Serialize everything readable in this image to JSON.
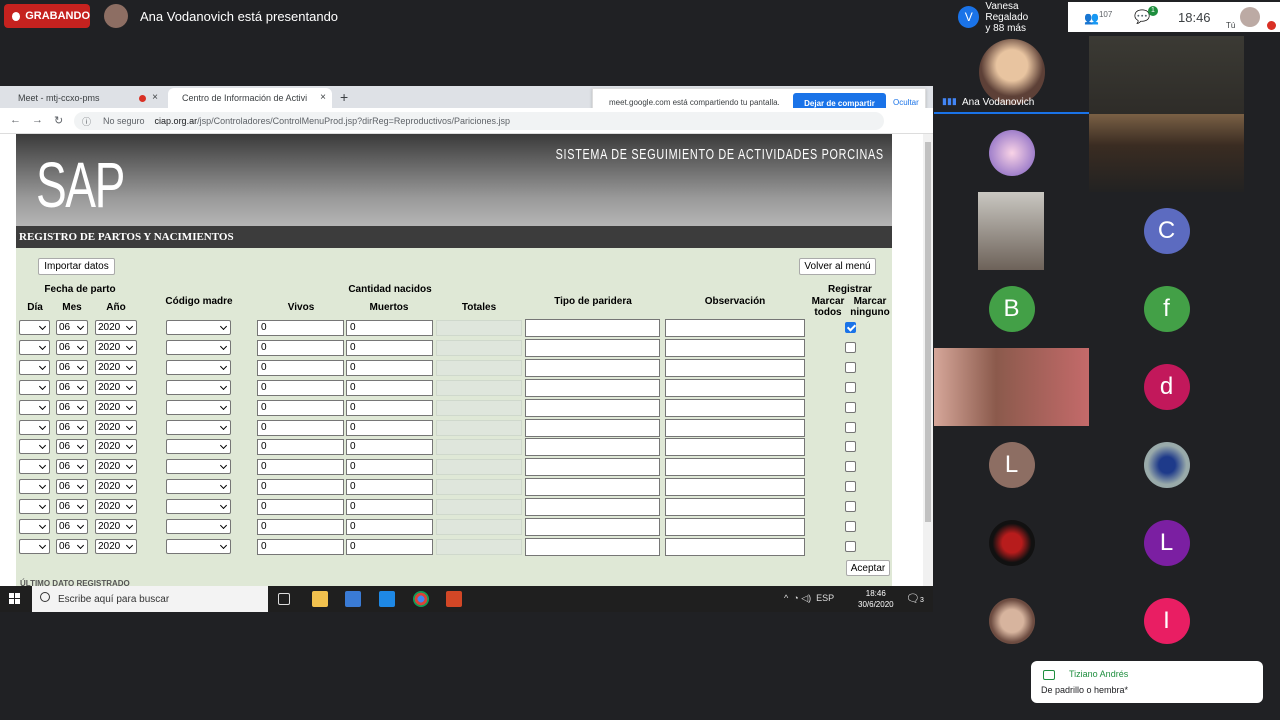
{
  "meet": {
    "recording_label": "GRABANDO",
    "presenting_text": "Ana Vodanovich está presentando",
    "participants_box": {
      "line1": "Vanesa Regalado",
      "line2": "y 88 más",
      "initial": "V"
    },
    "people_count": "107",
    "chat_badge": "1",
    "clock": "18:46",
    "self_label": "Tú",
    "speaker_name": "Ana Vodanovich",
    "tiles": [
      "C",
      "B",
      "f",
      "d",
      "L",
      "L",
      "I"
    ],
    "toast": {
      "name": "Tiziano Andrés",
      "message": "De padrillo o hembra*"
    }
  },
  "browser": {
    "tab1": "Meet - mtj-ccxo-pms",
    "tab2": "Centro de Información de Activi",
    "new_tab": "+",
    "share_message": "meet.google.com está compartiendo tu pantalla.",
    "stop_share": "Dejar de compartir",
    "hide": "Ocultar",
    "not_secure": "No seguro",
    "url_host": "ciap.org.ar",
    "url_path": "/jsp/Controladores/ControlMenuProd.jsp?dirReg=Reproductivos/Pariciones.jsp"
  },
  "page": {
    "logo": "SAP",
    "system_title": "SISTEMA DE SEGUIMIENTO DE ACTIVIDADES PORCINAS",
    "section_title": "REGISTRO DE PARTOS Y NACIMIENTOS",
    "import_button": "Importar datos",
    "back_button": "Volver al menú",
    "accept_button": "Aceptar",
    "last_record": "ÚLTIMO DATO REGISTRADO",
    "headers": {
      "fecha_parto": "Fecha de parto",
      "dia": "Día",
      "mes": "Mes",
      "anio": "Año",
      "codigo_madre": "Código madre",
      "cantidad_nacidos": "Cantidad nacidos",
      "vivos": "Vivos",
      "muertos": "Muertos",
      "totales": "Totales",
      "tipo_paridera": "Tipo de paridera",
      "observacion": "Observación",
      "registrar": "Registrar",
      "marcar_todos": "Marcar todos",
      "marcar_ninguno": "Marcar ninguno"
    },
    "rows": [
      {
        "mes": "06",
        "anio": "2020",
        "vivos": "0",
        "muertos": "0",
        "checked": true
      },
      {
        "mes": "06",
        "anio": "2020",
        "vivos": "0",
        "muertos": "0",
        "checked": false
      },
      {
        "mes": "06",
        "anio": "2020",
        "vivos": "0",
        "muertos": "0",
        "checked": false
      },
      {
        "mes": "06",
        "anio": "2020",
        "vivos": "0",
        "muertos": "0",
        "checked": false
      },
      {
        "mes": "06",
        "anio": "2020",
        "vivos": "0",
        "muertos": "0",
        "checked": false
      },
      {
        "mes": "06",
        "anio": "2020",
        "vivos": "0",
        "muertos": "0",
        "checked": false
      },
      {
        "mes": "06",
        "anio": "2020",
        "vivos": "0",
        "muertos": "0",
        "checked": false
      },
      {
        "mes": "06",
        "anio": "2020",
        "vivos": "0",
        "muertos": "0",
        "checked": false
      },
      {
        "mes": "06",
        "anio": "2020",
        "vivos": "0",
        "muertos": "0",
        "checked": false
      },
      {
        "mes": "06",
        "anio": "2020",
        "vivos": "0",
        "muertos": "0",
        "checked": false
      },
      {
        "mes": "06",
        "anio": "2020",
        "vivos": "0",
        "muertos": "0",
        "checked": false
      },
      {
        "mes": "06",
        "anio": "2020",
        "vivos": "0",
        "muertos": "0",
        "checked": false
      }
    ]
  },
  "taskbar": {
    "search_placeholder": "Escribe aquí para buscar",
    "language": "ESP",
    "time": "18:46",
    "date": "30/6/2020",
    "notif_count": "3"
  }
}
